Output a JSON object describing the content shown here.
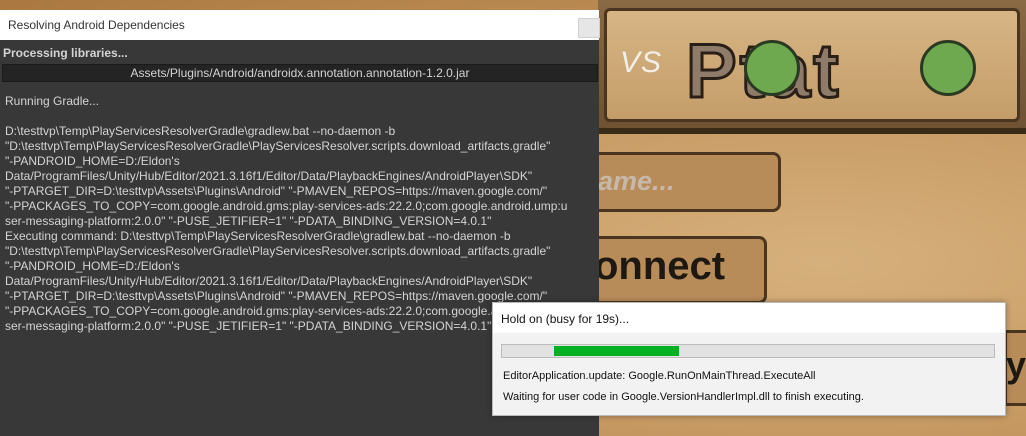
{
  "resolver_window": {
    "title": "Resolving Android Dependencies",
    "processing_label": "Processing libraries...",
    "current_file": "Assets/Plugins/Android/androidx.annotation.annotation-1.2.0.jar",
    "log_text": "Running Gradle...\n\nD:\\testtvp\\Temp\\PlayServicesResolverGradle\\gradlew.bat --no-daemon -b\n\"D:\\testtvp\\Temp\\PlayServicesResolverGradle\\PlayServicesResolver.scripts.download_artifacts.gradle\"\n\"-PANDROID_HOME=D:/Eldon's\nData/ProgramFiles/Unity/Hub/Editor/2021.3.16f1/Editor/Data/PlaybackEngines/AndroidPlayer\\SDK\"\n\"-PTARGET_DIR=D:\\testtvp\\Assets\\Plugins\\Android\" \"-PMAVEN_REPOS=https://maven.google.com/\"\n\"-PPACKAGES_TO_COPY=com.google.android.gms:play-services-ads:22.2.0;com.google.android.ump:u\nser-messaging-platform:2.0.0\" \"-PUSE_JETIFIER=1\" \"-PDATA_BINDING_VERSION=4.0.1\"\nExecuting command: D:\\testtvp\\Temp\\PlayServicesResolverGradle\\gradlew.bat --no-daemon -b\n\"D:\\testtvp\\Temp\\PlayServicesResolverGradle\\PlayServicesResolver.scripts.download_artifacts.gradle\"\n\"-PANDROID_HOME=D:/Eldon's\nData/ProgramFiles/Unity/Hub/Editor/2021.3.16f1/Editor/Data/PlaybackEngines/AndroidPlayer\\SDK\"\n\"-PTARGET_DIR=D:\\testtvp\\Assets\\Plugins\\Android\" \"-PMAVEN_REPOS=https://maven.google.com/\"\n\"-PPACKAGES_TO_COPY=com.google.android.gms:play-services-ads:22.2.0;com.google.android.ump:u\nser-messaging-platform:2.0.0\" \"-PUSE_JETIFIER=1\" \"-PDATA_BINDING_VERSION=4.0.1\""
  },
  "busy_dialog": {
    "title": "Hold on (busy for 19s)...",
    "progress_start": 0.105,
    "progress_end": 0.36,
    "progress_color": "#06b025",
    "line1": "EditorApplication.update: Google.RunOnMainThread.ExecuteAll",
    "line2": "Waiting for user code in Google.VersionHandlerImpl.dll to finish executing."
  },
  "game_screen": {
    "vs_label": "VS",
    "title_word": "Ptat",
    "name_placeholder": "ame...",
    "connect_label": "onnect",
    "play_glyph": "y"
  },
  "colors": {
    "editor_dark": "#383838",
    "dialog_light": "#f2f2f2",
    "game_wood": "#b88c58"
  },
  "icons": {
    "potato_face_1": "potato-face-icon",
    "potato_face_2": "potato-face-icon"
  }
}
